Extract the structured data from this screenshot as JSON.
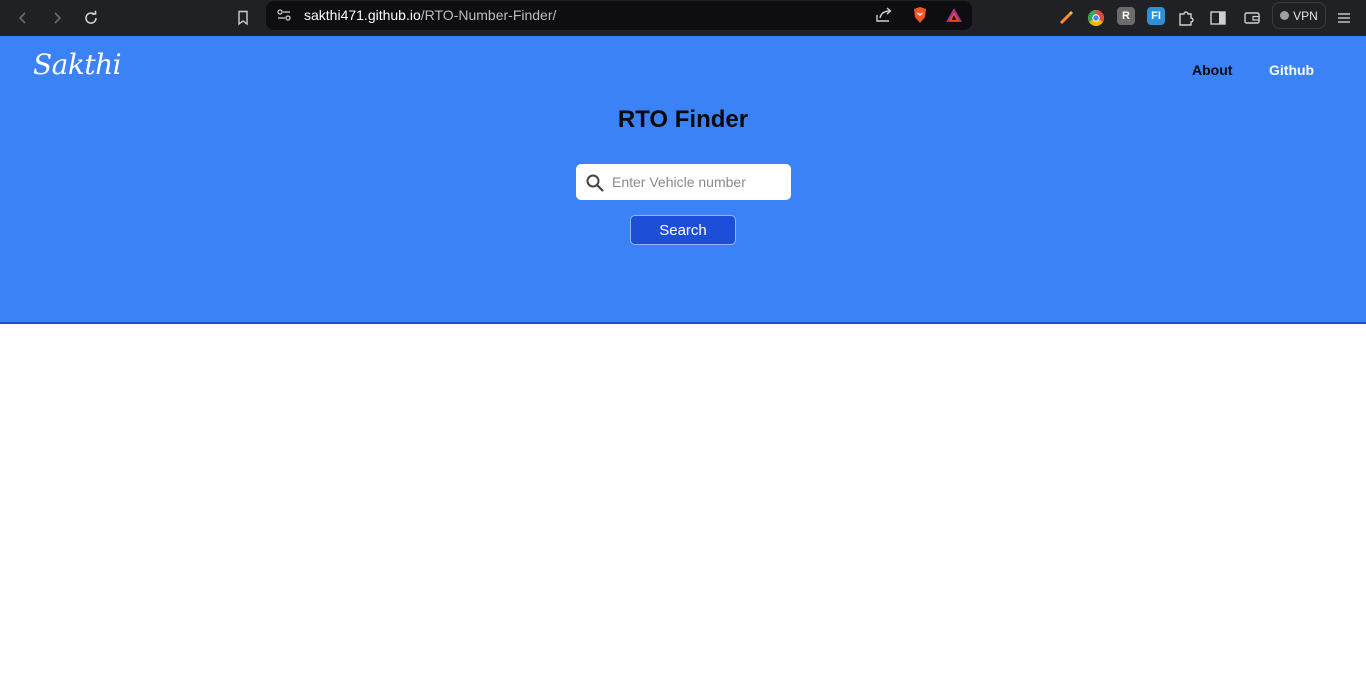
{
  "browser": {
    "url_host": "sakthi471.github.io",
    "url_path": "/RTO-Number-Finder/",
    "vpn_label": "VPN",
    "icons": [
      "back-icon",
      "forward-icon",
      "reload-icon",
      "bookmark-icon",
      "site-info-icon",
      "share-icon",
      "brave-shields-icon",
      "brave-rewards-icon",
      "extension-pen-icon",
      "extension-chrome-icon",
      "extension-r-icon",
      "extension-fi-icon",
      "extensions-puzzle-icon",
      "sidebar-icon",
      "wallet-icon",
      "menu-icon"
    ],
    "ext_r_label": "R",
    "ext_fi_label": "FI"
  },
  "header": {
    "logo": "Sakthi",
    "nav": {
      "about": "About",
      "github": "Github"
    }
  },
  "main": {
    "title": "RTO Finder",
    "search_placeholder": "Enter Vehicle number",
    "search_value": "",
    "search_button": "Search"
  },
  "colors": {
    "hero_bg": "#3b82f6",
    "button_bg": "#1d4ed8",
    "chrome_bg": "#202124"
  }
}
